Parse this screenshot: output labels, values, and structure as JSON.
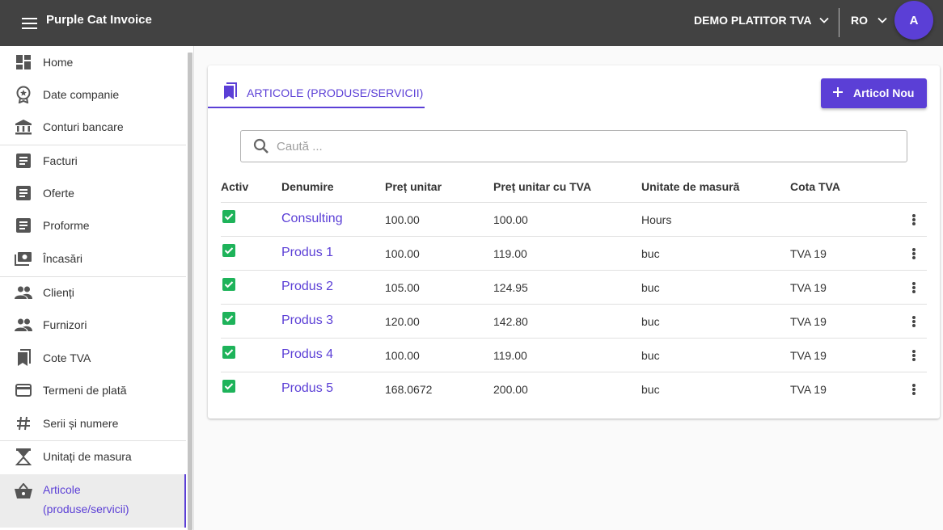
{
  "app": {
    "title": "Purple Cat Invoice",
    "company": "DEMO PLATITOR TVA",
    "language": "RO",
    "avatar_initial": "A",
    "accent_color": "#5b3fd6",
    "topbar_color": "#424242"
  },
  "sidebar": {
    "items": [
      {
        "label": "Home",
        "icon": "dashboard-icon"
      },
      {
        "label": "Date companie",
        "icon": "award-badge-icon"
      },
      {
        "label": "Conturi bancare",
        "icon": "bank-icon"
      },
      {
        "label": "Facturi",
        "icon": "document-icon"
      },
      {
        "label": "Oferte",
        "icon": "document-icon"
      },
      {
        "label": "Proforme",
        "icon": "document-icon"
      },
      {
        "label": "Încasări",
        "icon": "money-icon"
      },
      {
        "label": "Clienți",
        "icon": "people-icon"
      },
      {
        "label": "Furnizori",
        "icon": "people-icon"
      },
      {
        "label": "Cote TVA",
        "icon": "bookmarks-icon"
      },
      {
        "label": "Termeni de plată",
        "icon": "credit-card-icon"
      },
      {
        "label": "Serii și numere",
        "icon": "hash-icon"
      },
      {
        "label": "Unitați de masura",
        "icon": "scale-icon"
      },
      {
        "label": "Articole (produse/servicii)",
        "icon": "basket-icon",
        "active": true
      }
    ]
  },
  "page": {
    "tab_label": "ARTICOLE (PRODUSE/SERVICII)",
    "add_button_label": "Articol Nou",
    "search_placeholder": "Caută ...",
    "search_value": ""
  },
  "table": {
    "headers": [
      "Activ",
      "Denumire",
      "Preț unitar",
      "Preț unitar cu TVA",
      "Unitate de masură",
      "Cota TVA"
    ],
    "rows": [
      {
        "active": true,
        "name": "Consulting",
        "unit_price": "100.00",
        "price_vat": "100.00",
        "unit": "Hours",
        "vat": ""
      },
      {
        "active": true,
        "name": "Produs 1",
        "unit_price": "100.00",
        "price_vat": "119.00",
        "unit": "buc",
        "vat": "TVA 19"
      },
      {
        "active": true,
        "name": "Produs 2",
        "unit_price": "105.00",
        "price_vat": "124.95",
        "unit": "buc",
        "vat": "TVA 19"
      },
      {
        "active": true,
        "name": "Produs 3",
        "unit_price": "120.00",
        "price_vat": "142.80",
        "unit": "buc",
        "vat": "TVA 19"
      },
      {
        "active": true,
        "name": "Produs 4",
        "unit_price": "100.00",
        "price_vat": "119.00",
        "unit": "buc",
        "vat": "TVA 19"
      },
      {
        "active": true,
        "name": "Produs 5",
        "unit_price": "168.0672",
        "price_vat": "200.00",
        "unit": "buc",
        "vat": "TVA 19"
      }
    ]
  }
}
